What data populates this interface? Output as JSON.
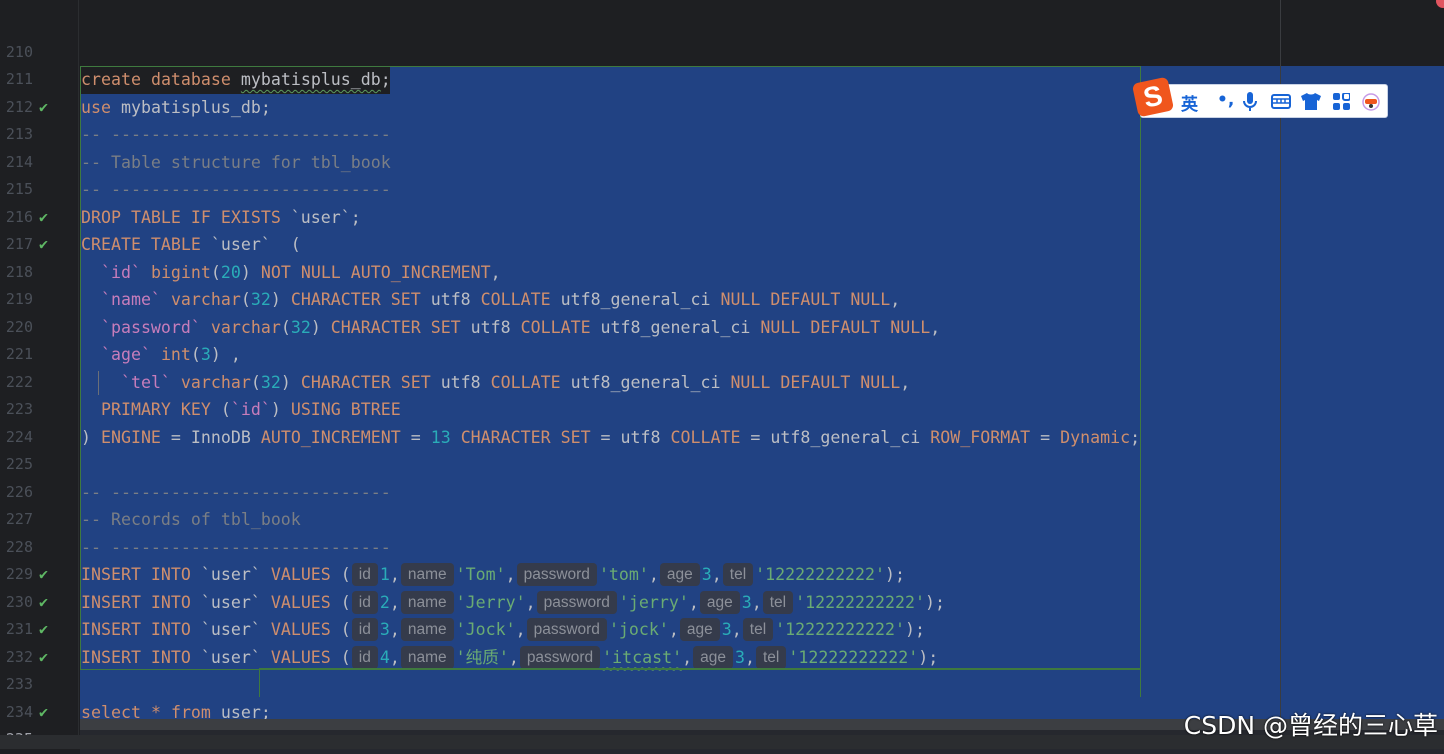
{
  "colors": {
    "background": "#1e1f22",
    "selection": "#214283",
    "keyword": "#cf8e6d",
    "comment": "#7a7e85",
    "number": "#2aacb8",
    "string": "#6aab73",
    "field": "#c77dbb",
    "checkmark": "#5fb865"
  },
  "current_line": "235",
  "lines": [
    {
      "no": "210",
      "check": false,
      "tokens": []
    },
    {
      "no": "211",
      "check": false,
      "tokens": [
        [
          "k",
          "create"
        ],
        [
          "p",
          " "
        ],
        [
          "k",
          "database"
        ],
        [
          "p",
          " "
        ],
        [
          "u",
          "mybatisplus_db"
        ],
        [
          "p",
          ";"
        ]
      ]
    },
    {
      "no": "212",
      "check": true,
      "tokens": [
        [
          "k",
          "use"
        ],
        [
          "p",
          " mybatisplus_db;"
        ]
      ]
    },
    {
      "no": "213",
      "check": false,
      "tokens": [
        [
          "c",
          "-- ----------------------------"
        ]
      ]
    },
    {
      "no": "214",
      "check": false,
      "tokens": [
        [
          "c",
          "-- Table structure for tbl_book"
        ]
      ]
    },
    {
      "no": "215",
      "check": false,
      "tokens": [
        [
          "c",
          "-- ----------------------------"
        ]
      ]
    },
    {
      "no": "216",
      "check": true,
      "tokens": [
        [
          "k",
          "DROP TABLE IF EXISTS"
        ],
        [
          "p",
          " `user`;"
        ]
      ]
    },
    {
      "no": "217",
      "check": true,
      "tokens": [
        [
          "k",
          "CREATE TABLE"
        ],
        [
          "p",
          " `user`  ("
        ]
      ]
    },
    {
      "no": "218",
      "check": false,
      "tokens": [
        [
          "p",
          "  "
        ],
        [
          "f",
          "`id`"
        ],
        [
          "p",
          " "
        ],
        [
          "k",
          "bigint"
        ],
        [
          "p",
          "("
        ],
        [
          "n",
          "20"
        ],
        [
          "p",
          ") "
        ],
        [
          "k",
          "NOT NULL AUTO_INCREMENT"
        ],
        [
          "p",
          ","
        ]
      ]
    },
    {
      "no": "219",
      "check": false,
      "tokens": [
        [
          "p",
          "  "
        ],
        [
          "f",
          "`name`"
        ],
        [
          "p",
          " "
        ],
        [
          "k",
          "varchar"
        ],
        [
          "p",
          "("
        ],
        [
          "n",
          "32"
        ],
        [
          "p",
          ") "
        ],
        [
          "k",
          "CHARACTER SET"
        ],
        [
          "p",
          " utf8 "
        ],
        [
          "k",
          "COLLATE"
        ],
        [
          "p",
          " utf8_general_ci "
        ],
        [
          "k",
          "NULL DEFAULT NULL"
        ],
        [
          "p",
          ","
        ]
      ]
    },
    {
      "no": "220",
      "check": false,
      "tokens": [
        [
          "p",
          "  "
        ],
        [
          "f",
          "`password`"
        ],
        [
          "p",
          " "
        ],
        [
          "k",
          "varchar"
        ],
        [
          "p",
          "("
        ],
        [
          "n",
          "32"
        ],
        [
          "p",
          ") "
        ],
        [
          "k",
          "CHARACTER SET"
        ],
        [
          "p",
          " utf8 "
        ],
        [
          "k",
          "COLLATE"
        ],
        [
          "p",
          " utf8_general_ci "
        ],
        [
          "k",
          "NULL DEFAULT NULL"
        ],
        [
          "p",
          ","
        ]
      ]
    },
    {
      "no": "221",
      "check": false,
      "tokens": [
        [
          "p",
          "  "
        ],
        [
          "f",
          "`age`"
        ],
        [
          "p",
          " "
        ],
        [
          "k",
          "int"
        ],
        [
          "p",
          "("
        ],
        [
          "n",
          "3"
        ],
        [
          "p",
          ") ,"
        ]
      ]
    },
    {
      "no": "222",
      "check": false,
      "guide": true,
      "tokens": [
        [
          "p",
          "    "
        ],
        [
          "f",
          "`tel`"
        ],
        [
          "p",
          " "
        ],
        [
          "k",
          "varchar"
        ],
        [
          "p",
          "("
        ],
        [
          "n",
          "32"
        ],
        [
          "p",
          ") "
        ],
        [
          "k",
          "CHARACTER SET"
        ],
        [
          "p",
          " utf8 "
        ],
        [
          "k",
          "COLLATE"
        ],
        [
          "p",
          " utf8_general_ci "
        ],
        [
          "k",
          "NULL DEFAULT NULL"
        ],
        [
          "p",
          ","
        ]
      ]
    },
    {
      "no": "223",
      "check": false,
      "tokens": [
        [
          "p",
          "  "
        ],
        [
          "k",
          "PRIMARY KEY"
        ],
        [
          "p",
          " ("
        ],
        [
          "f",
          "`id`"
        ],
        [
          "p",
          ") "
        ],
        [
          "k",
          "USING BTREE"
        ]
      ]
    },
    {
      "no": "224",
      "check": false,
      "tokens": [
        [
          "p",
          ") "
        ],
        [
          "k",
          "ENGINE"
        ],
        [
          "p",
          " = InnoDB "
        ],
        [
          "k",
          "AUTO_INCREMENT"
        ],
        [
          "p",
          " = "
        ],
        [
          "n",
          "13"
        ],
        [
          "p",
          " "
        ],
        [
          "k",
          "CHARACTER SET"
        ],
        [
          "p",
          " = utf8 "
        ],
        [
          "k",
          "COLLATE"
        ],
        [
          "p",
          " = utf8_general_ci "
        ],
        [
          "k",
          "ROW_FORMAT"
        ],
        [
          "p",
          " = "
        ],
        [
          "k",
          "Dynamic"
        ],
        [
          "p",
          ";"
        ]
      ]
    },
    {
      "no": "225",
      "check": false,
      "tokens": []
    },
    {
      "no": "226",
      "check": false,
      "tokens": [
        [
          "c",
          "-- ----------------------------"
        ]
      ]
    },
    {
      "no": "227",
      "check": false,
      "tokens": [
        [
          "c",
          "-- Records of tbl_book"
        ]
      ]
    },
    {
      "no": "228",
      "check": false,
      "tokens": [
        [
          "c",
          "-- ----------------------------"
        ]
      ]
    },
    {
      "no": "229",
      "check": true,
      "tokens": [
        [
          "k",
          "INSERT INTO"
        ],
        [
          "p",
          " `user` "
        ],
        [
          "k",
          "VALUES"
        ],
        [
          "p",
          " ("
        ],
        [
          "h",
          "id"
        ],
        [
          "n",
          "1"
        ],
        [
          "p",
          ","
        ],
        [
          "h",
          "name"
        ],
        [
          "s",
          "'Tom'"
        ],
        [
          "p",
          ","
        ],
        [
          "h",
          "password"
        ],
        [
          "s",
          "'tom'"
        ],
        [
          "p",
          ","
        ],
        [
          "h",
          "age"
        ],
        [
          "n",
          "3"
        ],
        [
          "p",
          ","
        ],
        [
          "h",
          "tel"
        ],
        [
          "s",
          "'12222222222'"
        ],
        [
          "p",
          ");"
        ]
      ]
    },
    {
      "no": "230",
      "check": true,
      "tokens": [
        [
          "k",
          "INSERT INTO"
        ],
        [
          "p",
          " `user` "
        ],
        [
          "k",
          "VALUES"
        ],
        [
          "p",
          " ("
        ],
        [
          "h",
          "id"
        ],
        [
          "n",
          "2"
        ],
        [
          "p",
          ","
        ],
        [
          "h",
          "name"
        ],
        [
          "s",
          "'Jerry'"
        ],
        [
          "p",
          ","
        ],
        [
          "h",
          "password"
        ],
        [
          "s",
          "'jerry'"
        ],
        [
          "p",
          ","
        ],
        [
          "h",
          "age"
        ],
        [
          "n",
          "3"
        ],
        [
          "p",
          ","
        ],
        [
          "h",
          "tel"
        ],
        [
          "s",
          "'12222222222'"
        ],
        [
          "p",
          ");"
        ]
      ]
    },
    {
      "no": "231",
      "check": true,
      "tokens": [
        [
          "k",
          "INSERT INTO"
        ],
        [
          "p",
          " `user` "
        ],
        [
          "k",
          "VALUES"
        ],
        [
          "p",
          " ("
        ],
        [
          "h",
          "id"
        ],
        [
          "n",
          "3"
        ],
        [
          "p",
          ","
        ],
        [
          "h",
          "name"
        ],
        [
          "s",
          "'Jock'"
        ],
        [
          "p",
          ","
        ],
        [
          "h",
          "password"
        ],
        [
          "s",
          "'jock'"
        ],
        [
          "p",
          ","
        ],
        [
          "h",
          "age"
        ],
        [
          "n",
          "3"
        ],
        [
          "p",
          ","
        ],
        [
          "h",
          "tel"
        ],
        [
          "s",
          "'12222222222'"
        ],
        [
          "p",
          ");"
        ]
      ]
    },
    {
      "no": "232",
      "check": true,
      "tokens": [
        [
          "k",
          "INSERT INTO"
        ],
        [
          "p",
          " `user` "
        ],
        [
          "k",
          "VALUES"
        ],
        [
          "p",
          " ("
        ],
        [
          "h",
          "id"
        ],
        [
          "n",
          "4"
        ],
        [
          "p",
          ","
        ],
        [
          "h",
          "name"
        ],
        [
          "s",
          "'纯质'"
        ],
        [
          "p",
          ","
        ],
        [
          "h",
          "password"
        ],
        [
          "us",
          "'itcast'"
        ],
        [
          "p",
          ","
        ],
        [
          "h",
          "age"
        ],
        [
          "n",
          "3"
        ],
        [
          "p",
          ","
        ],
        [
          "h",
          "tel"
        ],
        [
          "s",
          "'12222222222'"
        ],
        [
          "p",
          ");"
        ]
      ]
    },
    {
      "no": "233",
      "check": false,
      "tokens": []
    },
    {
      "no": "234",
      "check": true,
      "tokens": [
        [
          "k",
          "select"
        ],
        [
          "p",
          " "
        ],
        [
          "k",
          "*"
        ],
        [
          "p",
          " "
        ],
        [
          "k",
          "from"
        ],
        [
          "p",
          " user;"
        ]
      ]
    },
    {
      "no": "235",
      "check": false,
      "tokens": []
    }
  ],
  "ime_toolbar": {
    "logo": "S",
    "mode": "英",
    "punct": "•,",
    "icons": [
      "microphone-icon",
      "keyboard-icon",
      "skin-shirt-icon",
      "apps-grid-icon",
      "mascot-icon"
    ]
  },
  "watermark": "CSDN @曾经的三心草"
}
